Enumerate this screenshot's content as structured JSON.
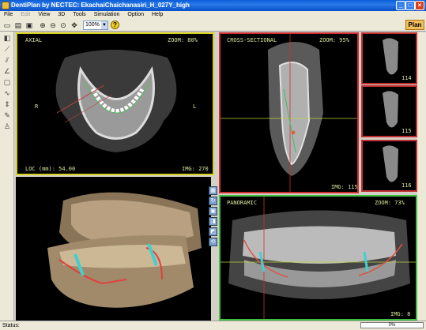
{
  "window": {
    "title": "DentiPlan by NECTEC: EkachaiChaichanasiri_H_027Y_high"
  },
  "menu": [
    "File",
    "Edit",
    "View",
    "3D",
    "Tools",
    "Simulation",
    "Option",
    "Help"
  ],
  "toolbar": {
    "zoom_value": "100%",
    "plan_label": "Plan"
  },
  "axial": {
    "title": "AXIAL",
    "zoom": "ZOOM: 80%",
    "loc": "LOC (mm): 54.00",
    "img": "IMG: 270",
    "left_marker": "R",
    "right_marker": "L"
  },
  "cross_sectional": {
    "title": "CROSS-SECTIONAL",
    "zoom": "ZOOM: 95%",
    "img": "IMG: 115"
  },
  "thumbnails": [
    {
      "label": "114"
    },
    {
      "label": "115"
    },
    {
      "label": "116"
    }
  ],
  "panoramic": {
    "title": "PANORAMIC",
    "zoom": "ZOOM: 73%",
    "img": "IMG: 8"
  },
  "status": {
    "text": "Status:",
    "progress": "0%"
  },
  "colors": {
    "axial_border": "#d8d020",
    "cross_border": "#cc3030",
    "pano_border": "#40c040",
    "label_text": "#d8e89a",
    "accent": "#f0c060"
  },
  "icons": [
    "app-icon",
    "new-icon",
    "open-icon",
    "save-icon",
    "zoom-in-icon",
    "zoom-out-icon",
    "pan-icon",
    "help-icon"
  ]
}
